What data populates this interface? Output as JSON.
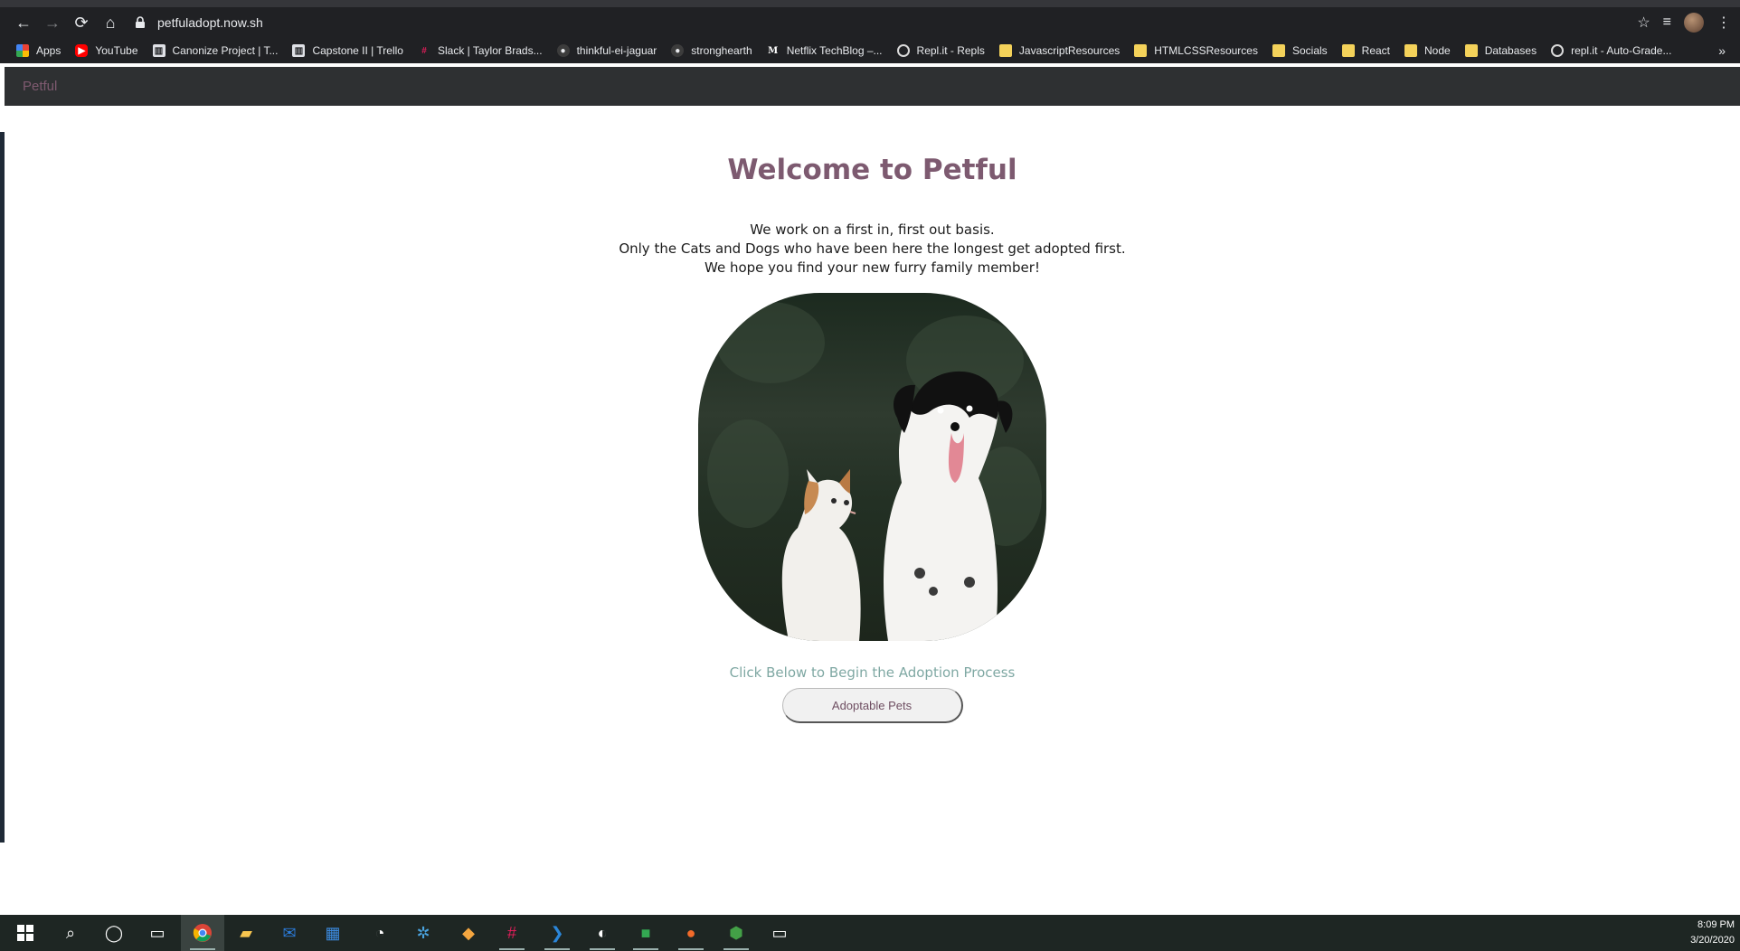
{
  "browser": {
    "url": "petfuladopt.now.sh",
    "bookmarks": [
      {
        "label": "Apps",
        "icon": "apps-grid-icon"
      },
      {
        "label": "YouTube",
        "icon": "youtube-icon"
      },
      {
        "label": "Canonize Project | T...",
        "icon": "trello-icon"
      },
      {
        "label": "Capstone II | Trello",
        "icon": "trello-icon"
      },
      {
        "label": "Slack | Taylor Brads...",
        "icon": "slack-icon"
      },
      {
        "label": "thinkful-ei-jaguar",
        "icon": "github-icon"
      },
      {
        "label": "stronghearth",
        "icon": "github-icon"
      },
      {
        "label": "Netflix TechBlog –...",
        "icon": "medium-icon"
      },
      {
        "label": "Repl.it - Repls",
        "icon": "replit-icon"
      },
      {
        "label": "JavascriptResources",
        "icon": "folder-icon"
      },
      {
        "label": "HTMLCSSResources",
        "icon": "folder-icon"
      },
      {
        "label": "Socials",
        "icon": "folder-icon"
      },
      {
        "label": "React",
        "icon": "folder-icon"
      },
      {
        "label": "Node",
        "icon": "folder-icon"
      },
      {
        "label": "Databases",
        "icon": "folder-icon"
      },
      {
        "label": "repl.it - Auto-Grade...",
        "icon": "replit-icon"
      }
    ],
    "more_bookmarks": "»"
  },
  "app": {
    "brand": "Petful",
    "title": "Welcome to Petful",
    "intro_lines": [
      "We work on a first in, first out basis.",
      "Only the Cats and Dogs who have been here the longest get adopted first.",
      "We hope you find your new furry family member!"
    ],
    "cta_text": "Click Below to Begin the Adoption Process",
    "button_label": "Adoptable Pets"
  },
  "taskbar": {
    "time": "8:09 PM",
    "date": "3/20/2020"
  }
}
